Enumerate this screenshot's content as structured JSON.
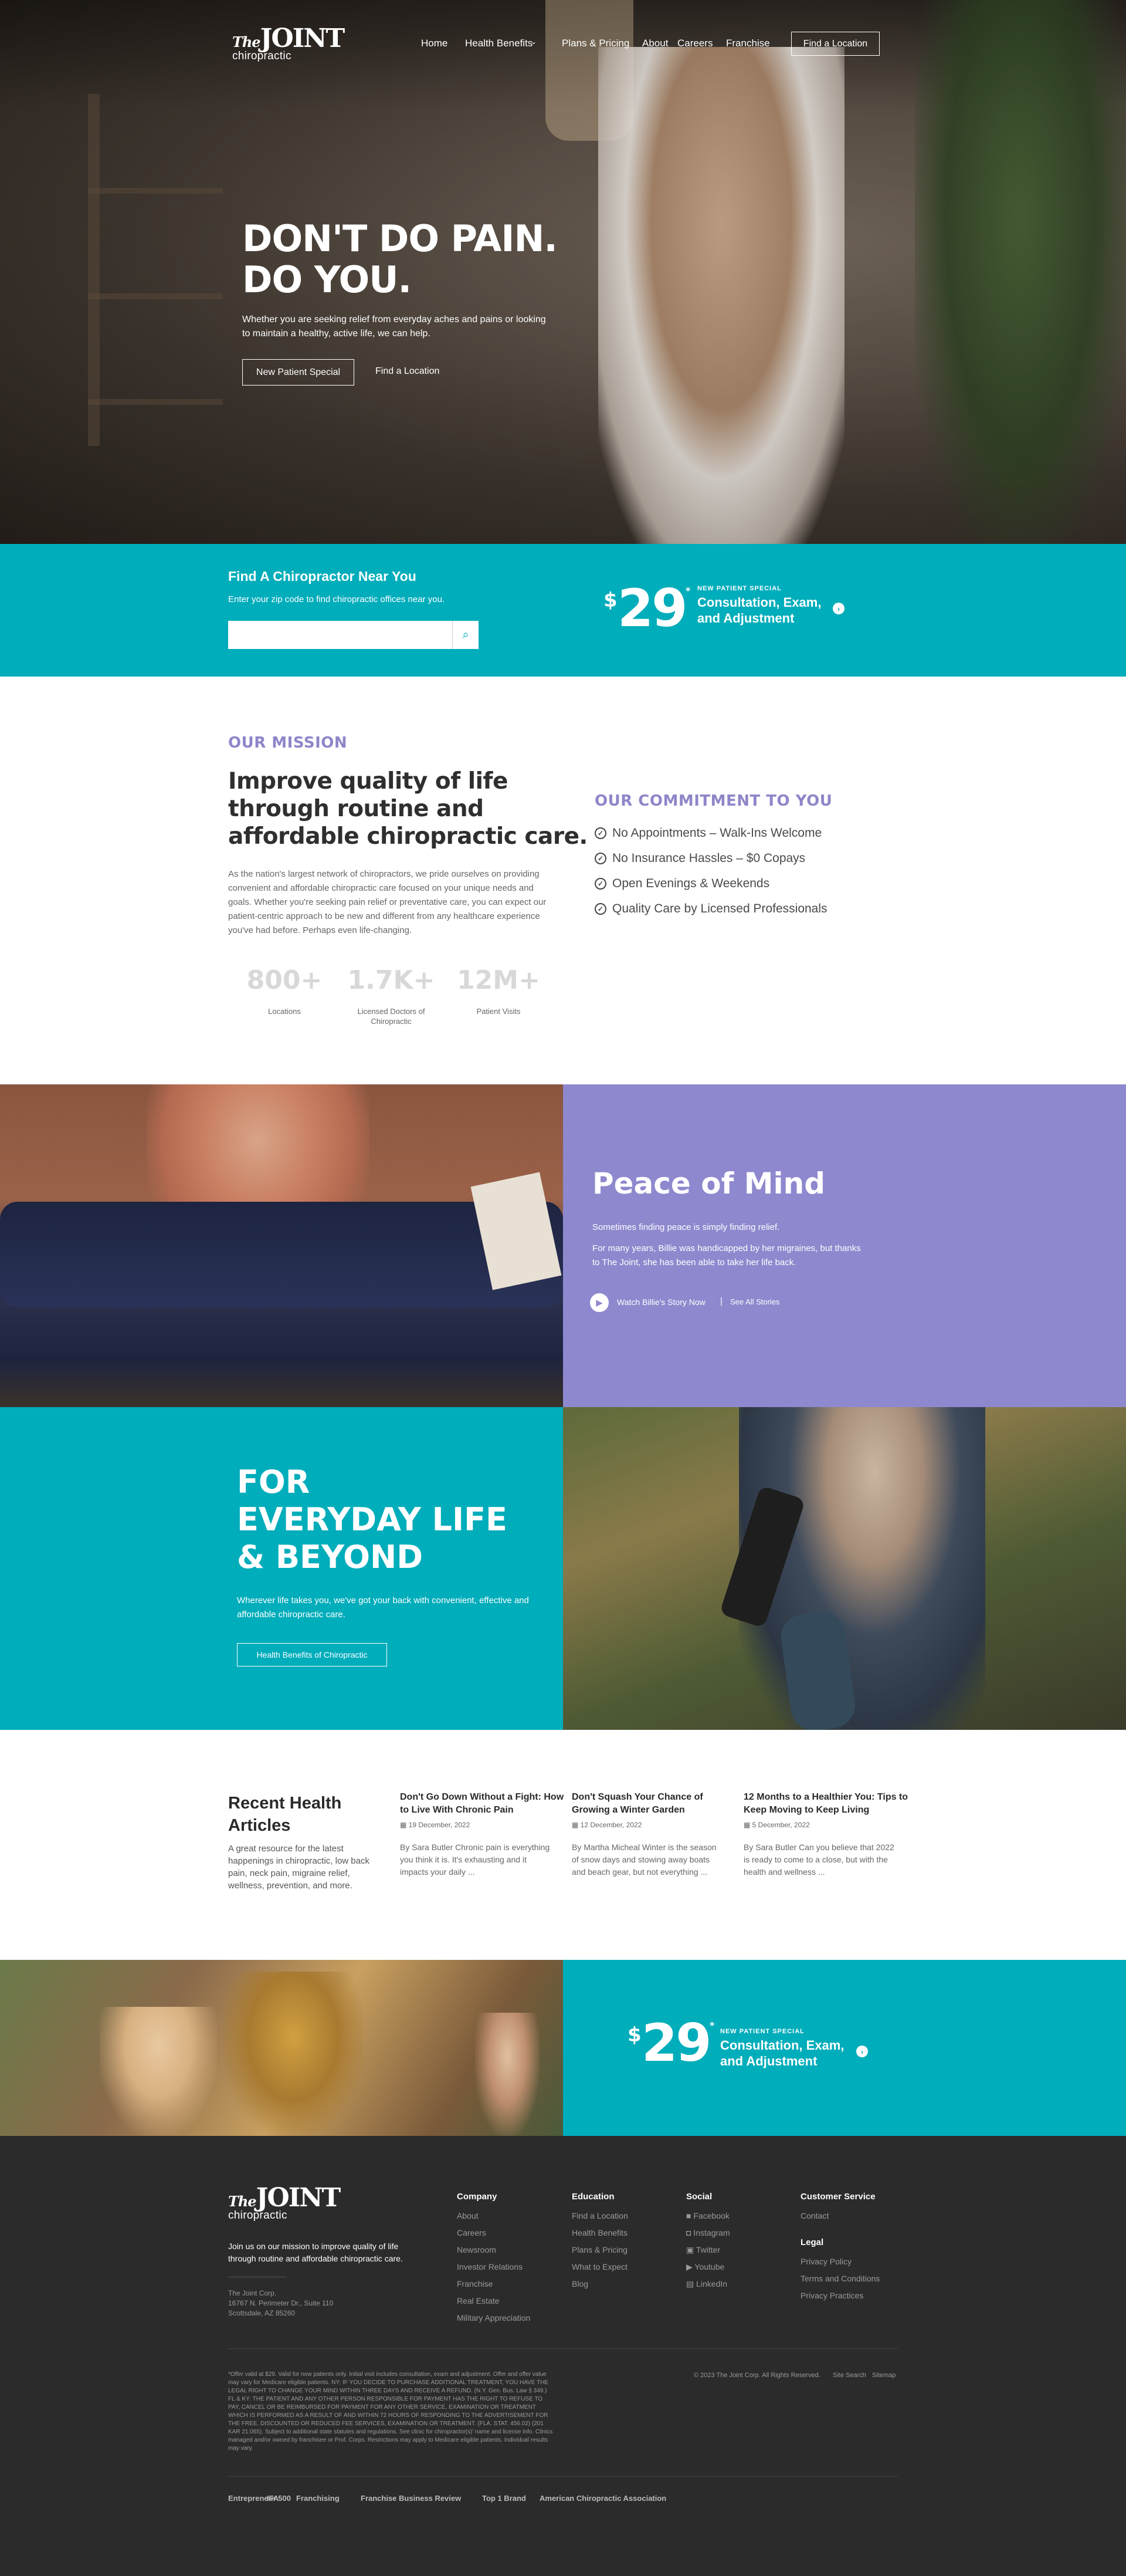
{
  "brand": {
    "logo_the": "The",
    "logo_joint": "JOINT",
    "logo_sub": "chiropractic"
  },
  "nav": {
    "items": [
      "Home",
      "Health Benefits",
      "Plans & Pricing",
      "About",
      "Careers",
      "Franchise"
    ],
    "cta": "Find a Location"
  },
  "hero": {
    "headline_1": "DON'T DO PAIN.",
    "headline_2": "DO YOU.",
    "subtext": "Whether you are seeking relief from everyday aches and pains or looking to maintain a healthy, active life, we can help.",
    "primary_button": "New Patient Special",
    "secondary_link": "Find a Location"
  },
  "find": {
    "title": "Find A Chiropractor Near You",
    "subtitle": "Enter your zip code to find chiropractic offices near you.",
    "input_value": "",
    "input_placeholder": ""
  },
  "special": {
    "dollar": "$",
    "price": "29",
    "asterisk": "*",
    "label": "NEW PATIENT SPECIAL",
    "title_1": "Consultation, Exam,",
    "title_2": "and Adjustment"
  },
  "mission": {
    "eyebrow": "OUR MISSION",
    "headline_1": "Improve quality of life",
    "headline_2": "through routine and",
    "headline_3": "affordable chiropractic care.",
    "body": "As the nation's largest network of chiropractors, we pride ourselves on providing convenient and affordable chiropractic care focused on your unique needs and goals. Whether you're seeking pain relief or preventative care, you can expect our patient-centric approach to be new and different from any healthcare experience you've had before. Perhaps even life-changing.",
    "stats": [
      {
        "value": "800+",
        "label": "Locations"
      },
      {
        "value": "1.7K+",
        "label": "Licensed Doctors of Chiropractic"
      },
      {
        "value": "12M+",
        "label": "Patient Visits"
      }
    ]
  },
  "commitment": {
    "eyebrow": "OUR COMMITMENT TO YOU",
    "items": [
      "No Appointments – Walk-Ins Welcome",
      "No Insurance Hassles – $0 Copays",
      "Open Evenings & Weekends",
      "Quality Care by Licensed Professionals"
    ]
  },
  "peace": {
    "title": "Peace of Mind",
    "lead": "Sometimes finding peace is simply finding relief.",
    "body": "For many years, Billie was handicapped by her migraines, but thanks to The Joint, she has been able to take her life back.",
    "watch_label": "Watch Billie's Story Now",
    "divider": "|",
    "all_stories": "See All Stories"
  },
  "everyday": {
    "title_1": "FOR",
    "title_2": "EVERYDAY LIFE",
    "title_3": "& BEYOND",
    "body": "Wherever life takes you, we've got your back with convenient, effective and affordable chiropractic care.",
    "button": "Health Benefits of Chiropractic"
  },
  "articles": {
    "heading_1": "Recent Health",
    "heading_2": "Articles",
    "intro": "A great resource for the latest happenings in chiropractic, low back pain, neck pain, migraine relief, wellness, prevention, and more.",
    "items": [
      {
        "title": "Don't Go Down Without a Fight: How to Live With Chronic Pain",
        "date": "19 December, 2022",
        "excerpt": "By Sara Butler Chronic pain is everything you think it is. It's exhausting and it impacts your daily ..."
      },
      {
        "title": "Don't Squash Your Chance of Growing a Winter Garden",
        "date": "12 December, 2022",
        "excerpt": "By Martha Micheal Winter is the season of snow days and stowing away boats and beach gear, but not everything ..."
      },
      {
        "title": "12 Months to a Healthier You: Tips to Keep Moving to Keep Living",
        "date": "5 December, 2022",
        "excerpt": "By Sara Butler Can you believe that 2022 is ready to come to a close, but with the health and wellness ..."
      }
    ]
  },
  "footer": {
    "tagline": "Join us on our mission to improve quality of life through routine and affordable chiropractic care.",
    "address_1": "The Joint Corp.",
    "address_2": "16767 N. Perimeter Dr., Suite 110",
    "address_3": "Scottsdale, AZ 85260",
    "columns": [
      {
        "heading": "Company",
        "links": [
          "About",
          "Careers",
          "Newsroom",
          "Investor Relations",
          "Franchise",
          "Real Estate",
          "Military Appreciation"
        ]
      },
      {
        "heading": "Education",
        "links": [
          "Find a Location",
          "Health Benefits",
          "Plans & Pricing",
          "What to Expect",
          "Blog"
        ]
      },
      {
        "heading": "Social",
        "links": [
          "Facebook",
          "Instagram",
          "Twitter",
          "Youtube",
          "LinkedIn"
        ]
      },
      {
        "heading": "Customer Service",
        "links": [
          "Contact"
        ]
      },
      {
        "heading": "Legal",
        "links": [
          "Privacy Policy",
          "Terms and Conditions",
          "Privacy Practices"
        ]
      }
    ],
    "copyright": "© 2023 The Joint Corp. All Rights Reserved.",
    "site_search": "Site Search",
    "sitemap": "Sitemap",
    "disclaimer": "*Offer valid at $29. Valid for new patients only. Initial visit includes consultation, exam and adjustment. Offer and offer value may vary for Medicare eligible patients. NY: IF YOU DECIDE TO PURCHASE ADDITIONAL TREATMENT, YOU HAVE THE LEGAL RIGHT TO CHANGE YOUR MIND WITHIN THREE DAYS AND RECEIVE A REFUND. (N.Y. Gen. Bus. Law § 349.) FL & KY: THE PATIENT AND ANY OTHER PERSON RESPONSIBLE FOR PAYMENT HAS THE RIGHT TO REFUSE TO PAY, CANCEL OR BE REIMBURSED FOR PAYMENT FOR ANY OTHER SERVICE, EXAMINATION OR TREATMENT WHICH IS PERFORMED AS A RESULT OF AND WITHIN 72 HOURS OF RESPONDING TO THE ADVERTISEMENT FOR THE FREE, DISCOUNTED OR REDUCED FEE SERVICES, EXAMINATION OR TREATMENT. (FLA. STAT. 456.02) (201 KAR 21:065). Subject to additional state statutes and regulations. See clinic for chiropractor(s)' name and license info. Clinics managed and/or owned by franchisee or Prof. Corps. Restrictions may apply to Medicare eligible patients. Individual results may vary.",
    "associations": [
      "Entrepreneur 500",
      "IFA",
      "Franchising",
      "Franchise Business Review",
      "Top 1 Brand",
      "American Chiropractic Association"
    ]
  },
  "colors": {
    "teal": "#00adbb",
    "purple": "#8e88ce",
    "dark": "#2b2b2b"
  }
}
